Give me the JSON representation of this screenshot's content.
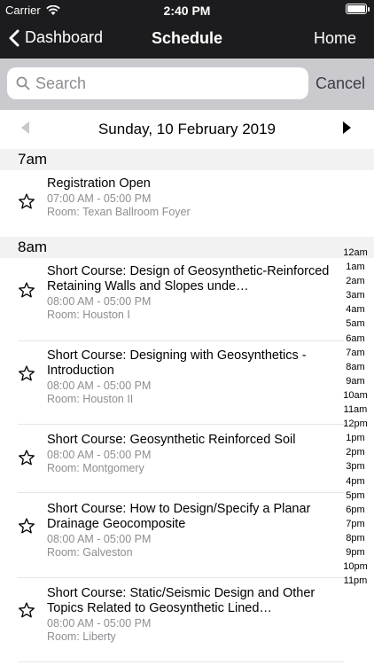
{
  "status": {
    "carrier": "Carrier",
    "time": "2:40 PM"
  },
  "nav": {
    "back_label": "Dashboard",
    "title": "Schedule",
    "home_label": "Home"
  },
  "search": {
    "placeholder": "Search",
    "value": "",
    "cancel_label": "Cancel"
  },
  "date": {
    "label": "Sunday, 10 February 2019"
  },
  "sections": [
    {
      "label": "7am"
    },
    {
      "label": "8am"
    }
  ],
  "items": [
    {
      "name": "Registration Open",
      "time": "07:00 AM - 05:00 PM",
      "room": "Room: Texan Ballroom Foyer"
    },
    {
      "name": "Short Course: Design of Geosynthetic-Reinforced Retaining Walls and Slopes unde…",
      "time": "08:00 AM - 05:00 PM",
      "room": "Room: Houston I"
    },
    {
      "name": "Short Course: Designing with Geosynthetics - Introduction",
      "time": "08:00 AM - 05:00 PM",
      "room": "Room: Houston II"
    },
    {
      "name": "Short Course: Geosynthetic Reinforced Soil",
      "time": "08:00 AM - 05:00 PM",
      "room": "Room: Montgomery"
    },
    {
      "name": "Short Course: How to Design/Specify a Planar Drainage Geocomposite",
      "time": "08:00 AM - 05:00 PM",
      "room": "Room: Galveston"
    },
    {
      "name": "Short Course: Static/Seismic Design and Other Topics Related to Geosynthetic Lined…",
      "time": "08:00 AM - 05:00 PM",
      "room": "Room: Liberty"
    }
  ],
  "index": [
    "12am",
    "1am",
    "2am",
    "3am",
    "4am",
    "5am",
    "6am",
    "7am",
    "8am",
    "9am",
    "10am",
    "11am",
    "12pm",
    "1pm",
    "2pm",
    "3pm",
    "4pm",
    "5pm",
    "6pm",
    "7pm",
    "8pm",
    "9pm",
    "10pm",
    "11pm"
  ]
}
